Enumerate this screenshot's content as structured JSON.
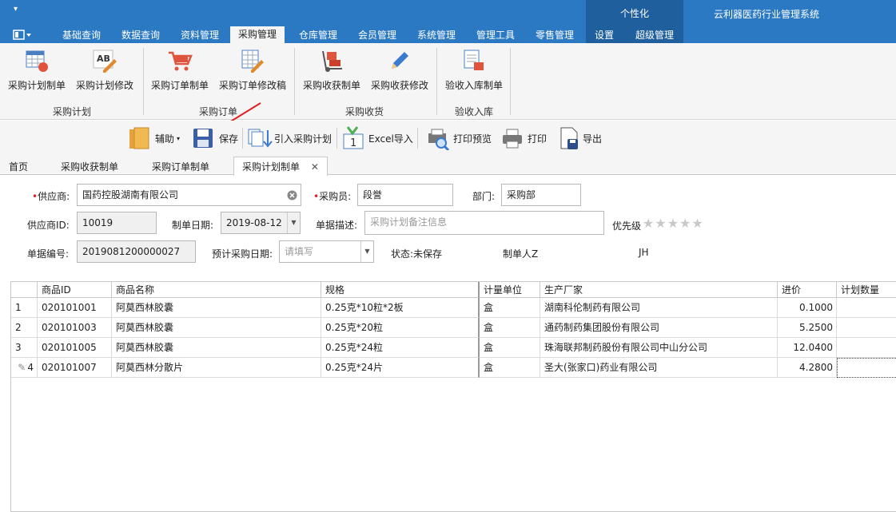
{
  "quick_access": "▾",
  "personalize": "个性化",
  "app_title": "云利器医药行业管理系统",
  "menu_tabs": [
    "基础查询",
    "数据查询",
    "资料管理",
    "采购管理",
    "仓库管理",
    "会员管理",
    "系统管理",
    "管理工具",
    "零售管理",
    "设置",
    "超级管理"
  ],
  "ribbon": {
    "buttons": [
      "采购计划制单",
      "采购计划修改",
      "采购订单制单",
      "采购订单修改稿",
      "采购收获制单",
      "采购收获修改",
      "验收入库制单"
    ],
    "groups": [
      "采购计划",
      "采购订单",
      "采购收货",
      "验收入库"
    ]
  },
  "toolbar": {
    "assist": "辅助",
    "save": "保存",
    "import_plan": "引入采购计划",
    "excel_import": "Excel导入",
    "print_preview": "打印预览",
    "print": "打印",
    "export": "导出"
  },
  "doc_tabs": [
    "首页",
    "采购收获制单",
    "采购订单制单",
    "采购计划制单"
  ],
  "form": {
    "supplier_label": "供应商:",
    "supplier_value": "国药控股湖南有限公司",
    "buyer_label": "采购员:",
    "buyer_value": "段誉",
    "dept_label": "部门:",
    "dept_value": "采购部",
    "supplier_id_label": "供应商ID:",
    "supplier_id_value": "10019",
    "create_date_label": "制单日期:",
    "create_date_value": "2019-08-12",
    "desc_label": "单据描述:",
    "desc_placeholder": "采购计划备注信息",
    "priority_label": "优先级",
    "stars": "★★★★★",
    "doc_no_label": "单据编号:",
    "doc_no_value": "2019081200000027",
    "expected_date_label": "预计采购日期:",
    "expected_date_placeholder": "请填写",
    "status_label": "状态:",
    "status_value": "未保存",
    "creator_label": "制单人Z",
    "creator_value": "JH"
  },
  "grid": {
    "columns": [
      "商品ID",
      "商品名称",
      "规格",
      "计量单位",
      "生产厂家",
      "进价",
      "计划数量"
    ],
    "rows": [
      {
        "idx": "1",
        "id": "020101001",
        "name": "阿莫西林胶囊",
        "spec": "0.25克*10粒*2板",
        "unit": "盒",
        "maker": "湖南科伦制药有限公司",
        "price": "0.1000"
      },
      {
        "idx": "2",
        "id": "020101003",
        "name": "阿莫西林胶囊",
        "spec": "0.25克*20粒",
        "unit": "盒",
        "maker": "通药制药集团股份有限公司",
        "price": "5.2500"
      },
      {
        "idx": "3",
        "id": "020101005",
        "name": "阿莫西林胶囊",
        "spec": "0.25克*24粒",
        "unit": "盒",
        "maker": "珠海联邦制药股份有限公司中山分公司",
        "price": "12.0400"
      },
      {
        "idx": "4",
        "id": "020101007",
        "name": "阿莫西林分散片",
        "spec": "0.25克*24片",
        "unit": "盒",
        "maker": "圣大(张家口)药业有限公司",
        "price": "4.2800"
      }
    ]
  }
}
